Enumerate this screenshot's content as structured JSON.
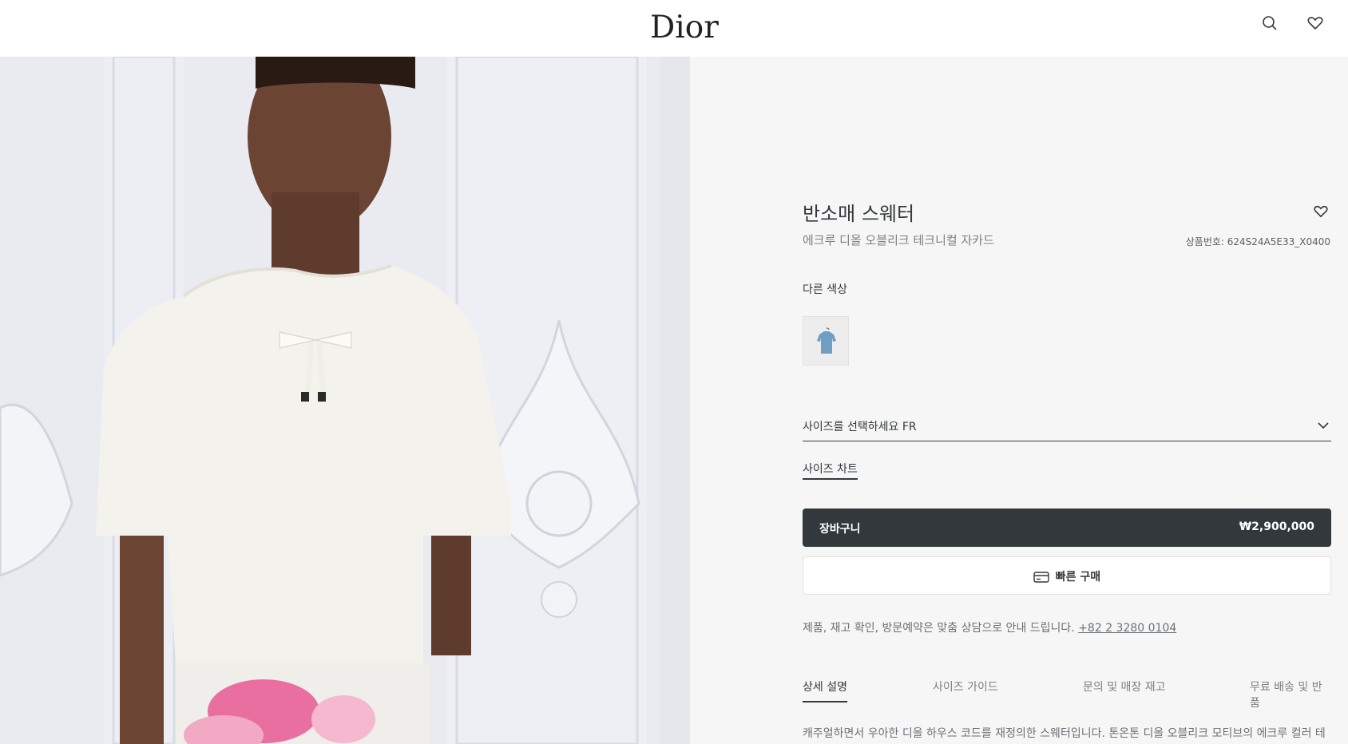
{
  "header": {
    "logo": "Dior",
    "icons": [
      "search-icon",
      "heart-icon"
    ]
  },
  "product": {
    "title": "반소매 스웨터",
    "subtitle": "에크루 디올 오블리크 테크니컬 자카드",
    "reference": "상품번호: 624S24A5E33_X0400",
    "colors_label": "다른 색상",
    "swatch_color": "#6e9ec4",
    "size_select": "사이즈를 선택하세요 FR",
    "size_chart": "사이즈 차트",
    "cart_label": "장바구니",
    "price": "₩2,900,000",
    "quick_buy": "빠른 구매",
    "contact_text": "제품, 재고 확인, 방문예약은 맞춤 상담으로 안내 드립니다.",
    "contact_phone": "+82 2 3280 0104"
  },
  "tabs": [
    {
      "label": "상세 설명",
      "active": true
    },
    {
      "label": "사이즈 가이드",
      "active": false
    },
    {
      "label": "문의 및 매장 재고",
      "active": false
    },
    {
      "label": "무료 배송 및 반품",
      "active": false
    }
  ],
  "description": "캐주얼하면서 우아한 디올 하우스 코드를 재정의한 스웨터입니다. 톤온톤 디올 오블리크 모티브의 에크루 컬러 테",
  "colors": {
    "dark": "#33383c",
    "panel_bg": "#f6f6f6"
  }
}
